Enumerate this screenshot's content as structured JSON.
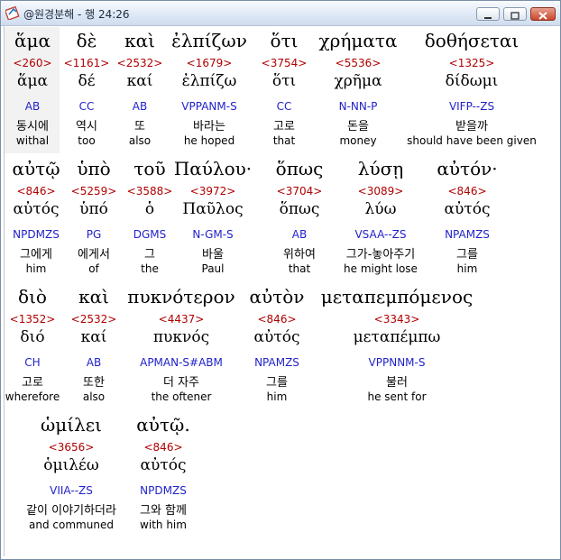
{
  "window": {
    "title": "@원경분해 - 행 24:26",
    "app_icon": "bible-app-icon"
  },
  "rows": [
    [
      {
        "greek": "ἅμα",
        "strong": "<260>",
        "lemma": "ἅμα",
        "parsing": "AB",
        "korean": "동시에",
        "english": "withal"
      },
      {
        "greek": "δὲ",
        "strong": "<1161>",
        "lemma": "δέ",
        "parsing": "CC",
        "korean": "역시",
        "english": "too"
      },
      {
        "greek": "καὶ",
        "strong": "<2532>",
        "lemma": "καί",
        "parsing": "AB",
        "korean": "또",
        "english": "also"
      },
      {
        "greek": "ἐλπίζων",
        "strong": "<1679>",
        "lemma": "ἐλπίζω",
        "parsing": "VPPANM-S",
        "korean": "바라는",
        "english": "he hoped"
      },
      {
        "greek": "ὅτι",
        "strong": "<3754>",
        "lemma": "ὅτι",
        "parsing": "CC",
        "korean": "고로",
        "english": "that"
      },
      {
        "greek": "χρήματα",
        "strong": "<5536>",
        "lemma": "χρῆμα",
        "parsing": "N-NN-P",
        "korean": "돈을",
        "english": "money"
      },
      {
        "greek": "δοθήσεται",
        "strong": "<1325>",
        "lemma": "δίδωμι",
        "parsing": "VIFP--ZS",
        "korean": "받을까",
        "english": "should have been given"
      }
    ],
    [
      {
        "greek": "αὐτῷ",
        "strong": "<846>",
        "lemma": "αὐτός",
        "parsing": "NPDMZS",
        "korean": "그에게",
        "english": "him"
      },
      {
        "greek": "ὑπὸ",
        "strong": "<5259>",
        "lemma": "ὑπό",
        "parsing": "PG",
        "korean": "에게서",
        "english": "of"
      },
      {
        "greek": "τοῦ",
        "strong": "<3588>",
        "lemma": "ὁ",
        "parsing": "DGMS",
        "korean": "그",
        "english": "the"
      },
      {
        "greek": "Παύλου·",
        "strong": "<3972>",
        "lemma": "Παῦλος",
        "parsing": "N-GM-S",
        "korean": "바울",
        "english": "Paul"
      },
      {
        "greek": "ὅπως",
        "strong": "<3704>",
        "lemma": "ὅπως",
        "parsing": "AB",
        "korean": "위하여",
        "english": "that"
      },
      {
        "greek": "λύσῃ",
        "strong": "<3089>",
        "lemma": "λύω",
        "parsing": "VSAA--ZS",
        "korean": "그가-놓아주기",
        "english": "he might lose"
      },
      {
        "greek": "αὐτόν·",
        "strong": "<846>",
        "lemma": "αὐτός",
        "parsing": "NPAMZS",
        "korean": "그를",
        "english": "him"
      }
    ],
    [
      {
        "greek": "διὸ",
        "strong": "<1352>",
        "lemma": "διό",
        "parsing": "CH",
        "korean": "고로",
        "english": "wherefore"
      },
      {
        "greek": "καὶ",
        "strong": "<2532>",
        "lemma": "καί",
        "parsing": "AB",
        "korean": "또한",
        "english": "also"
      },
      {
        "greek": "πυκνότερον",
        "strong": "<4437>",
        "lemma": "πυκνός",
        "parsing": "APMAN-S#ABM",
        "korean": "더 자주",
        "english": "the oftener"
      },
      {
        "greek": "αὐτὸν",
        "strong": "<846>",
        "lemma": "αὐτός",
        "parsing": "NPAMZS",
        "korean": "그를",
        "english": "him"
      },
      {
        "greek": "μεταπεμπόμενος",
        "strong": "<3343>",
        "lemma": "μεταπέμπω",
        "parsing": "VPPNNM-S",
        "korean": "불러",
        "english": "he sent for"
      }
    ],
    [
      {
        "greek": "ὡμίλει",
        "strong": "<3656>",
        "lemma": "ὁμιλέω",
        "parsing": "VIIA--ZS",
        "korean": "같이 이야기하더라",
        "english": "and communed"
      },
      {
        "greek": "αὐτῷ.",
        "strong": "<846>",
        "lemma": "αὐτός",
        "parsing": "NPDMZS",
        "korean": "그와 함께",
        "english": "with him"
      }
    ]
  ]
}
